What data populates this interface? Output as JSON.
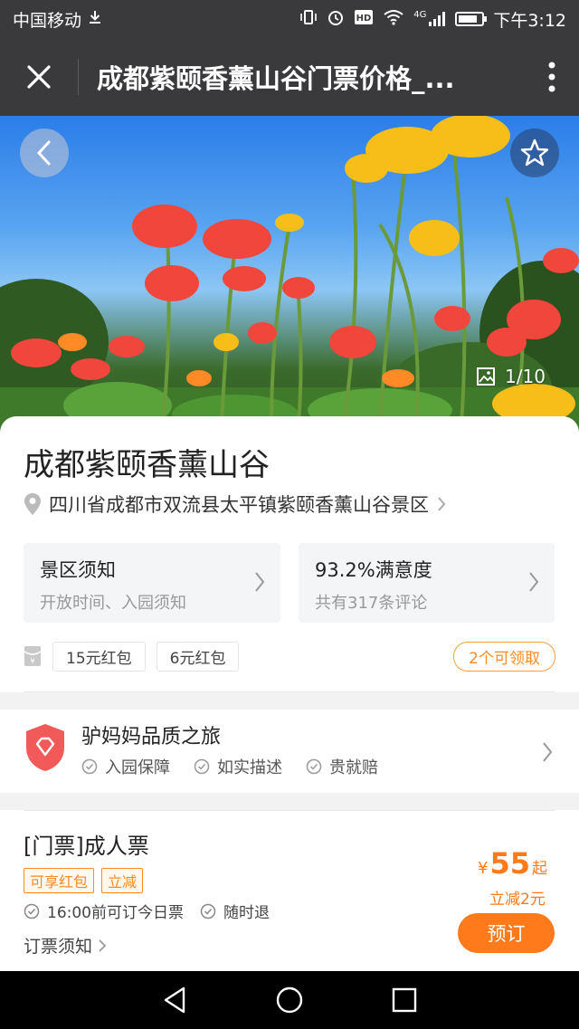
{
  "status_bar": {
    "carrier": "中国移动",
    "network": "4G",
    "time": "下午3:12",
    "battery_level": 0.8,
    "icons": [
      "download-icon",
      "vibrate-icon",
      "alarm-icon",
      "hd-icon",
      "wifi-icon",
      "signal-icon",
      "battery-icon"
    ]
  },
  "title_bar": {
    "title": "成都紫颐香薰山谷门票价格_..."
  },
  "hero": {
    "photo_counter": "1/10"
  },
  "attraction": {
    "name": "成都紫颐香薰山谷",
    "address": "四川省成都市双流县太平镇紫颐香薰山谷景区"
  },
  "info_boxes": {
    "notice_title": "景区须知",
    "notice_sub": "开放时间、入园须知",
    "rating_title": "93.2%满意度",
    "rating_sub": "共有317条评论"
  },
  "coupons": {
    "items": [
      "15元红包",
      "6元红包"
    ],
    "claim": "2个可领取"
  },
  "quality": {
    "title": "驴妈妈品质之旅",
    "features": [
      "入园保障",
      "如实描述",
      "贵就赔"
    ]
  },
  "ticket": {
    "name": "[门票]成人票",
    "tags": [
      "可享红包",
      "立减"
    ],
    "features": [
      "16:00前可订今日票",
      "随时退"
    ],
    "notice": "订票须知",
    "currency": "¥",
    "price": "55",
    "price_suffix": "起",
    "discount": "立减2元",
    "book_label": "预订"
  },
  "colors": {
    "accent": "#ff7a1a",
    "header": "#3a3a3c",
    "badge": "#f25a5a"
  }
}
